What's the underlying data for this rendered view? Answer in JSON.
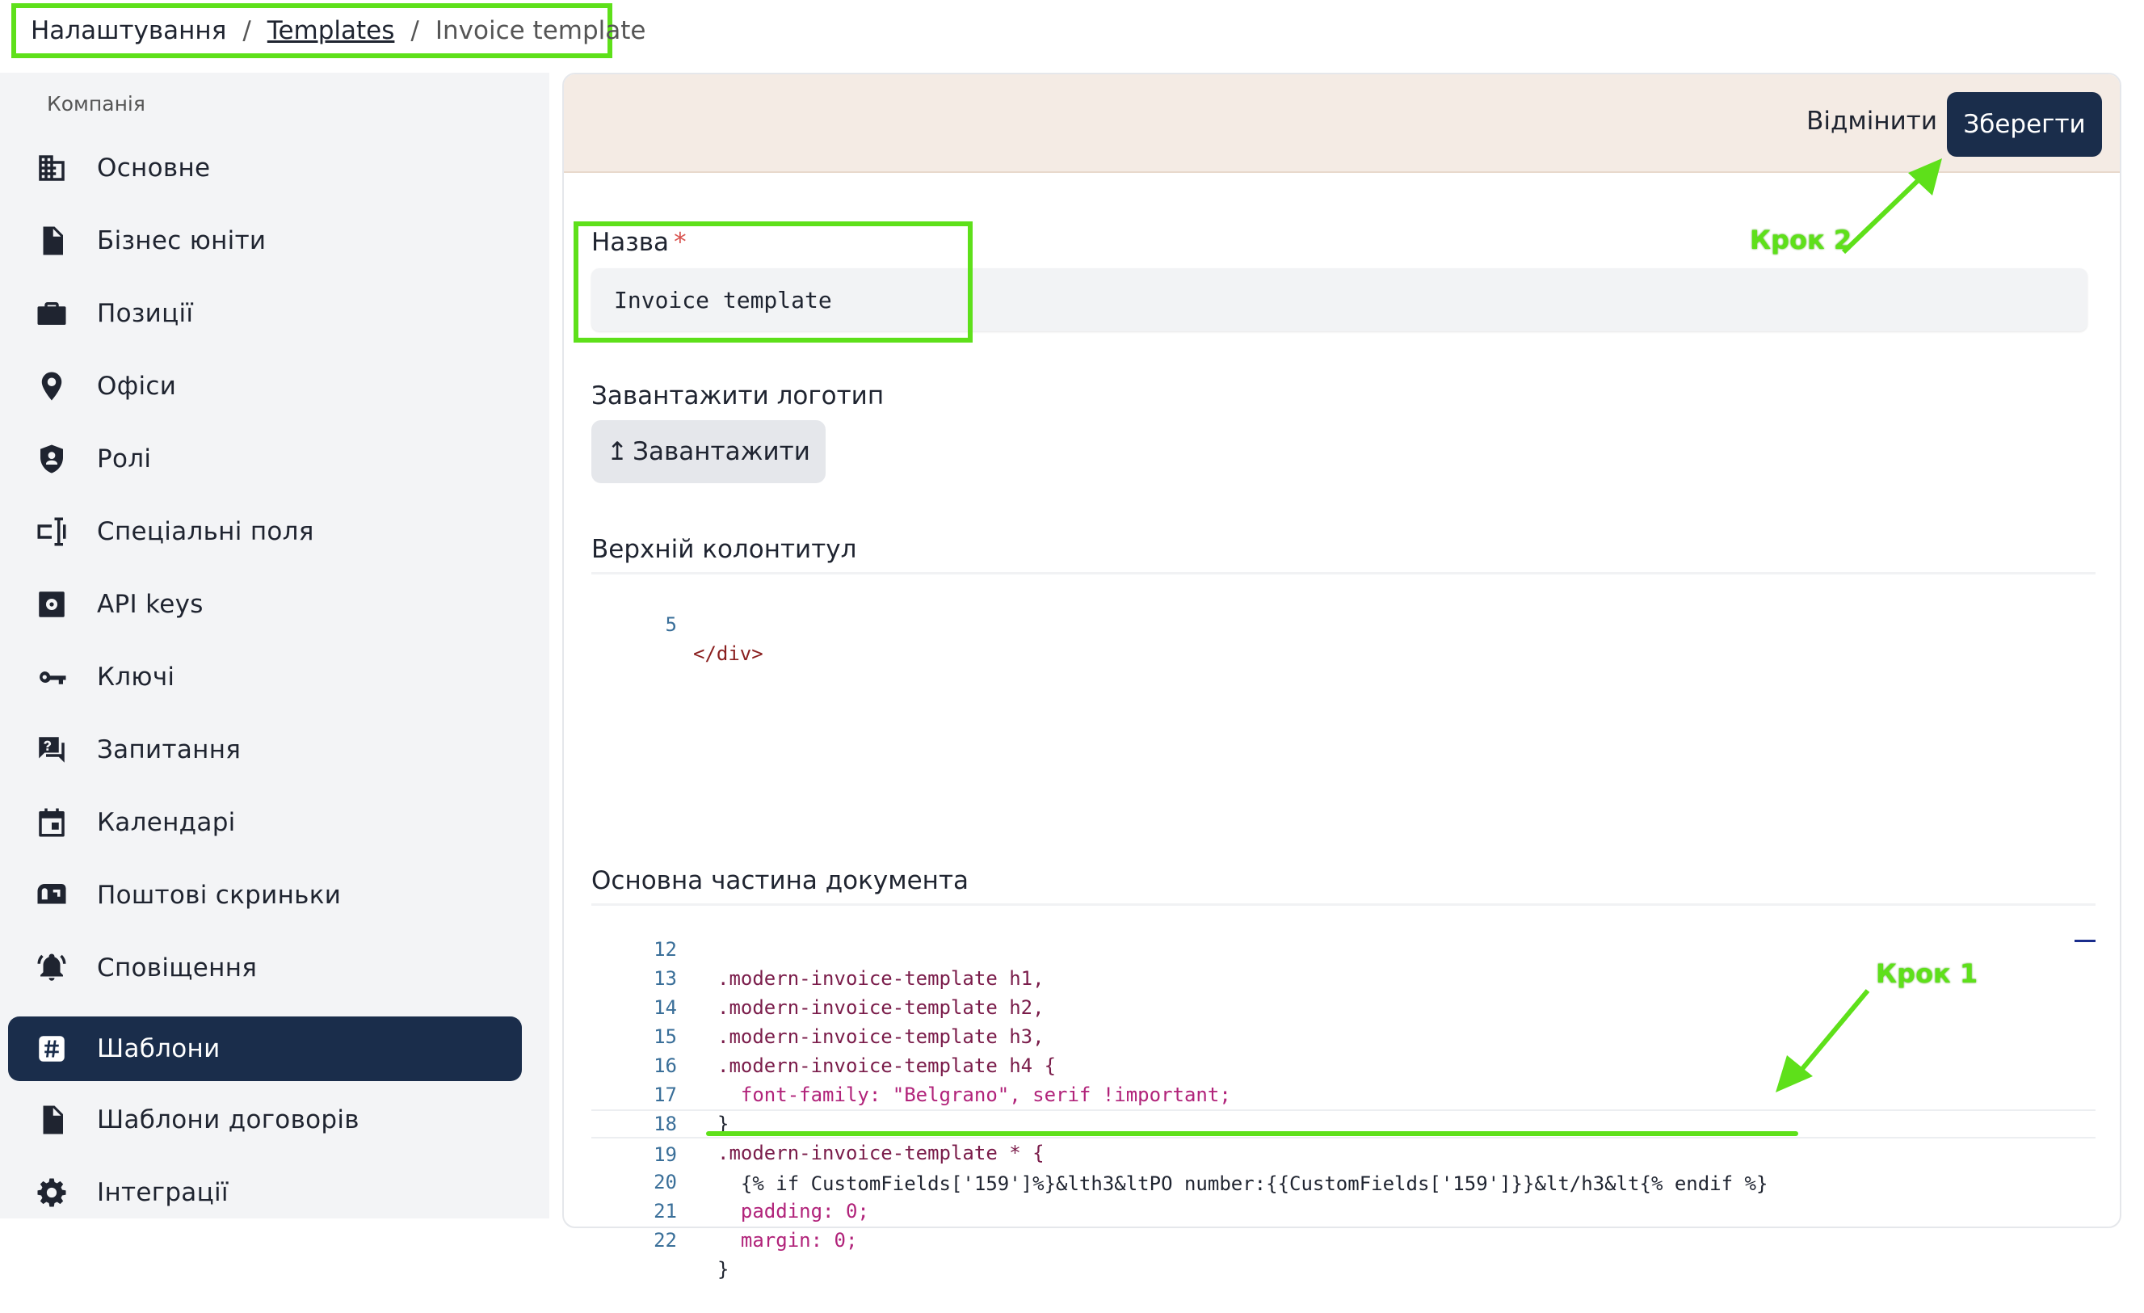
{
  "breadcrumb": {
    "root": "Налаштування",
    "separator": "/",
    "templates": "Templates",
    "current": "Invoice template"
  },
  "sidebar": {
    "group_label": "Компанія",
    "items": [
      {
        "label": "Основне",
        "icon": "building-icon"
      },
      {
        "label": "Бізнес юніти",
        "icon": "document-icon"
      },
      {
        "label": "Позиції",
        "icon": "briefcase-icon"
      },
      {
        "label": "Офіси",
        "icon": "location-pin-icon"
      },
      {
        "label": "Ролі",
        "icon": "shield-icon"
      },
      {
        "label": "Спеціальні поля",
        "icon": "custom-field-icon"
      },
      {
        "label": "API keys",
        "icon": "api-gear-icon"
      },
      {
        "label": "Ключі",
        "icon": "key-icon"
      },
      {
        "label": "Запитання",
        "icon": "question-chat-icon"
      },
      {
        "label": "Календарі",
        "icon": "calendar-icon"
      },
      {
        "label": "Поштові скриньки",
        "icon": "mailbox-icon"
      },
      {
        "label": "Сповіщення",
        "icon": "bell-icon"
      },
      {
        "label": "Шаблони",
        "icon": "hash-icon",
        "active": true
      },
      {
        "label": "Шаблони договорів",
        "icon": "file-icon"
      },
      {
        "label": "Інтеграції",
        "icon": "gear-icon"
      }
    ]
  },
  "toolbar": {
    "cancel_label": "Відмінити",
    "save_label": "Зберегти"
  },
  "form": {
    "name_label": "Назва",
    "name_required_mark": "*",
    "name_value": "Invoice template",
    "logo_label": "Завантажити логотип",
    "upload_label": "Завантажити",
    "upload_icon": "↥",
    "header_label": "Верхній колонтитул",
    "body_label": "Основна частина документа"
  },
  "header_editor": {
    "lines": [
      {
        "num": "5",
        "code": "</div>"
      }
    ]
  },
  "body_editor": {
    "lines": [
      {
        "num": "12",
        "code": ".modern-invoice-template h1,"
      },
      {
        "num": "13",
        "code": ".modern-invoice-template h2,"
      },
      {
        "num": "14",
        "code": ".modern-invoice-template h3,"
      },
      {
        "num": "15",
        "code": ".modern-invoice-template h4 {"
      },
      {
        "num": "16",
        "code": "  font-family: \"Belgrano\", serif !important;"
      },
      {
        "num": "17",
        "code": "}"
      },
      {
        "num": "18",
        "code": ".modern-invoice-template * {"
      },
      {
        "num": "19",
        "code": "  {% if CustomFields['159']%}&lth3&ltPO number:{{CustomFields['159']}}&lt/h3&lt{% endif %}"
      },
      {
        "num": "20",
        "code": "  padding: 0;"
      },
      {
        "num": "21",
        "code": "  margin: 0;"
      },
      {
        "num": "22",
        "code": "}"
      }
    ]
  },
  "annotations": {
    "step1": "Крок 1",
    "step2": "Крок 2",
    "highlight_color": "#5ee01a"
  }
}
